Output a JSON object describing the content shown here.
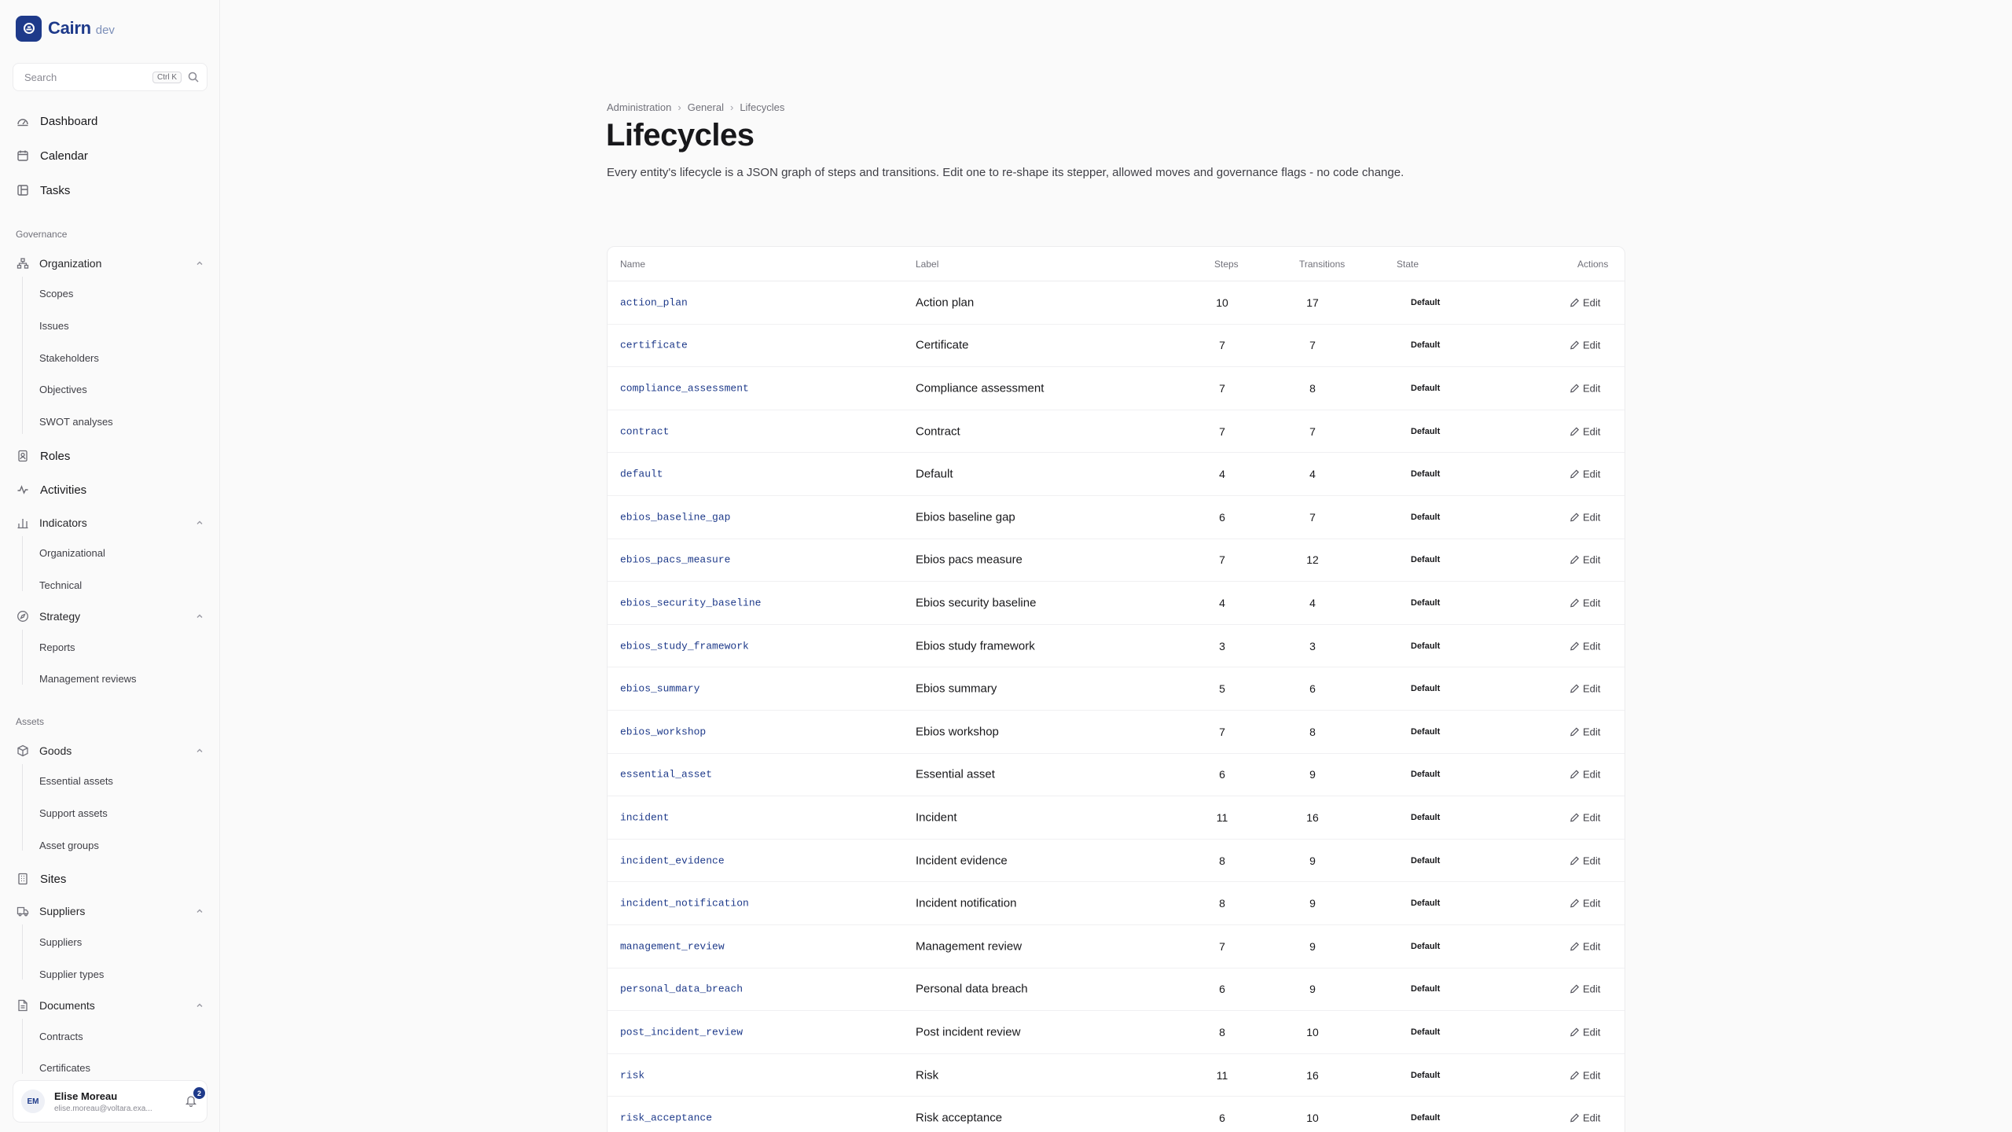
{
  "brand": {
    "name": "Cairn",
    "env": "dev"
  },
  "search": {
    "placeholder": "Search",
    "shortcut": "Ctrl K"
  },
  "nav_top": [
    {
      "label": "Dashboard",
      "icon": "dashboard-icon"
    },
    {
      "label": "Calendar",
      "icon": "calendar-icon"
    },
    {
      "label": "Tasks",
      "icon": "tasks-icon"
    }
  ],
  "sections": {
    "governance": "Governance",
    "assets": "Assets"
  },
  "governance": {
    "organization": {
      "label": "Organization",
      "items": [
        "Scopes",
        "Issues",
        "Stakeholders",
        "Objectives",
        "SWOT analyses"
      ]
    },
    "roles": "Roles",
    "activities": "Activities",
    "indicators": {
      "label": "Indicators",
      "items": [
        "Organizational",
        "Technical"
      ]
    },
    "strategy": {
      "label": "Strategy",
      "items": [
        "Reports",
        "Management reviews"
      ]
    }
  },
  "assets": {
    "goods": {
      "label": "Goods",
      "items": [
        "Essential assets",
        "Support assets",
        "Asset groups"
      ]
    },
    "sites": "Sites",
    "suppliers": {
      "label": "Suppliers",
      "items": [
        "Suppliers",
        "Supplier types"
      ]
    },
    "documents": {
      "label": "Documents",
      "items": [
        "Contracts",
        "Certificates"
      ]
    }
  },
  "user": {
    "initials": "EM",
    "name": "Elise Moreau",
    "email": "elise.moreau@voltara.exa...",
    "notifications": "2"
  },
  "breadcrumb": [
    "Administration",
    "General",
    "Lifecycles"
  ],
  "page": {
    "title": "Lifecycles",
    "description": "Every entity's lifecycle is a JSON graph of steps and transitions. Edit one to re-shape its stepper, allowed moves and governance flags - no code change."
  },
  "table": {
    "columns": {
      "name": "Name",
      "label": "Label",
      "steps": "Steps",
      "transitions": "Transitions",
      "state": "State",
      "actions": "Actions"
    },
    "edit_label": "Edit",
    "rows": [
      {
        "name": "action_plan",
        "label": "Action plan",
        "steps": "10",
        "transitions": "17",
        "state": "Default"
      },
      {
        "name": "certificate",
        "label": "Certificate",
        "steps": "7",
        "transitions": "7",
        "state": "Default"
      },
      {
        "name": "compliance_assessment",
        "label": "Compliance assessment",
        "steps": "7",
        "transitions": "8",
        "state": "Default"
      },
      {
        "name": "contract",
        "label": "Contract",
        "steps": "7",
        "transitions": "7",
        "state": "Default"
      },
      {
        "name": "default",
        "label": "Default",
        "steps": "4",
        "transitions": "4",
        "state": "Default"
      },
      {
        "name": "ebios_baseline_gap",
        "label": "Ebios baseline gap",
        "steps": "6",
        "transitions": "7",
        "state": "Default"
      },
      {
        "name": "ebios_pacs_measure",
        "label": "Ebios pacs measure",
        "steps": "7",
        "transitions": "12",
        "state": "Default"
      },
      {
        "name": "ebios_security_baseline",
        "label": "Ebios security baseline",
        "steps": "4",
        "transitions": "4",
        "state": "Default"
      },
      {
        "name": "ebios_study_framework",
        "label": "Ebios study framework",
        "steps": "3",
        "transitions": "3",
        "state": "Default"
      },
      {
        "name": "ebios_summary",
        "label": "Ebios summary",
        "steps": "5",
        "transitions": "6",
        "state": "Default"
      },
      {
        "name": "ebios_workshop",
        "label": "Ebios workshop",
        "steps": "7",
        "transitions": "8",
        "state": "Default"
      },
      {
        "name": "essential_asset",
        "label": "Essential asset",
        "steps": "6",
        "transitions": "9",
        "state": "Default"
      },
      {
        "name": "incident",
        "label": "Incident",
        "steps": "11",
        "transitions": "16",
        "state": "Default"
      },
      {
        "name": "incident_evidence",
        "label": "Incident evidence",
        "steps": "8",
        "transitions": "9",
        "state": "Default"
      },
      {
        "name": "incident_notification",
        "label": "Incident notification",
        "steps": "8",
        "transitions": "9",
        "state": "Default"
      },
      {
        "name": "management_review",
        "label": "Management review",
        "steps": "7",
        "transitions": "9",
        "state": "Default"
      },
      {
        "name": "personal_data_breach",
        "label": "Personal data breach",
        "steps": "6",
        "transitions": "9",
        "state": "Default"
      },
      {
        "name": "post_incident_review",
        "label": "Post incident review",
        "steps": "8",
        "transitions": "10",
        "state": "Default"
      },
      {
        "name": "risk",
        "label": "Risk",
        "steps": "11",
        "transitions": "16",
        "state": "Default"
      },
      {
        "name": "risk_acceptance",
        "label": "Risk acceptance",
        "steps": "6",
        "transitions": "10",
        "state": "Default"
      }
    ]
  }
}
